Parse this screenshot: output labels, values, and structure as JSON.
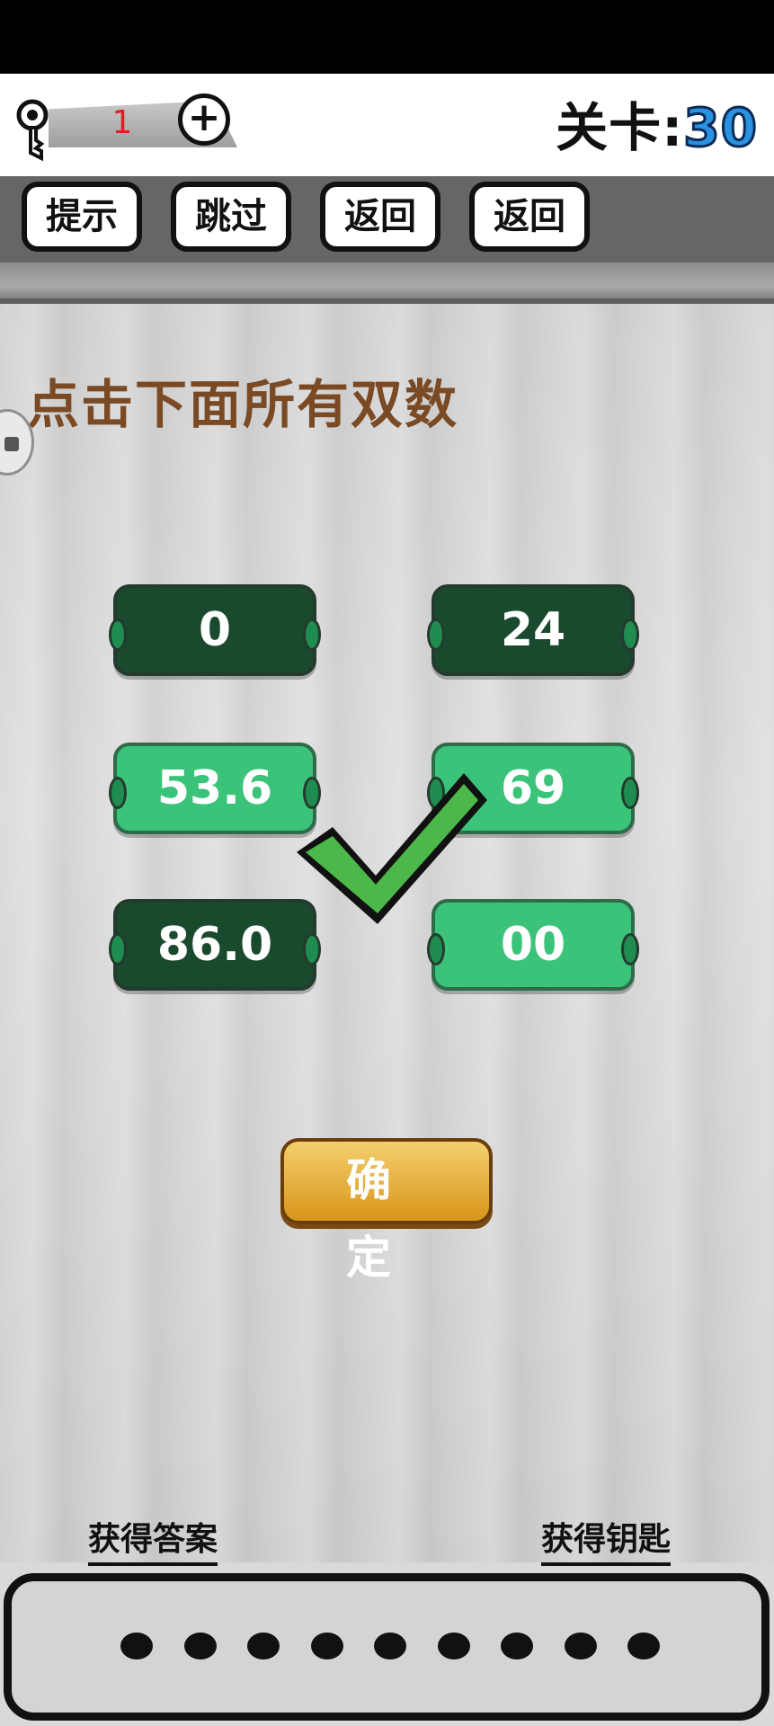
{
  "header": {
    "key_count": "1",
    "level_label": "关卡:",
    "level_number": "30"
  },
  "toolbar": {
    "buttons": [
      "提示",
      "跳过",
      "返回",
      "返回"
    ]
  },
  "puzzle": {
    "question": "点击下面所有双数",
    "tiles": [
      {
        "value": "0",
        "selected": true
      },
      {
        "value": "24",
        "selected": true
      },
      {
        "value": "53.6",
        "selected": false
      },
      {
        "value": "69",
        "selected": false
      },
      {
        "value": "86.0",
        "selected": true
      },
      {
        "value": "00",
        "selected": false
      }
    ],
    "confirm_label": "确 定"
  },
  "footer": {
    "get_answer": "获得答案",
    "get_key": "获得钥匙",
    "answer_slots": 9
  },
  "colors": {
    "tile_selected": "#1a4a2d",
    "tile_unselected": "#3bc37a",
    "check": "#4cb84a",
    "level_number": "#2a92e0",
    "question_text": "#7a4a24"
  }
}
